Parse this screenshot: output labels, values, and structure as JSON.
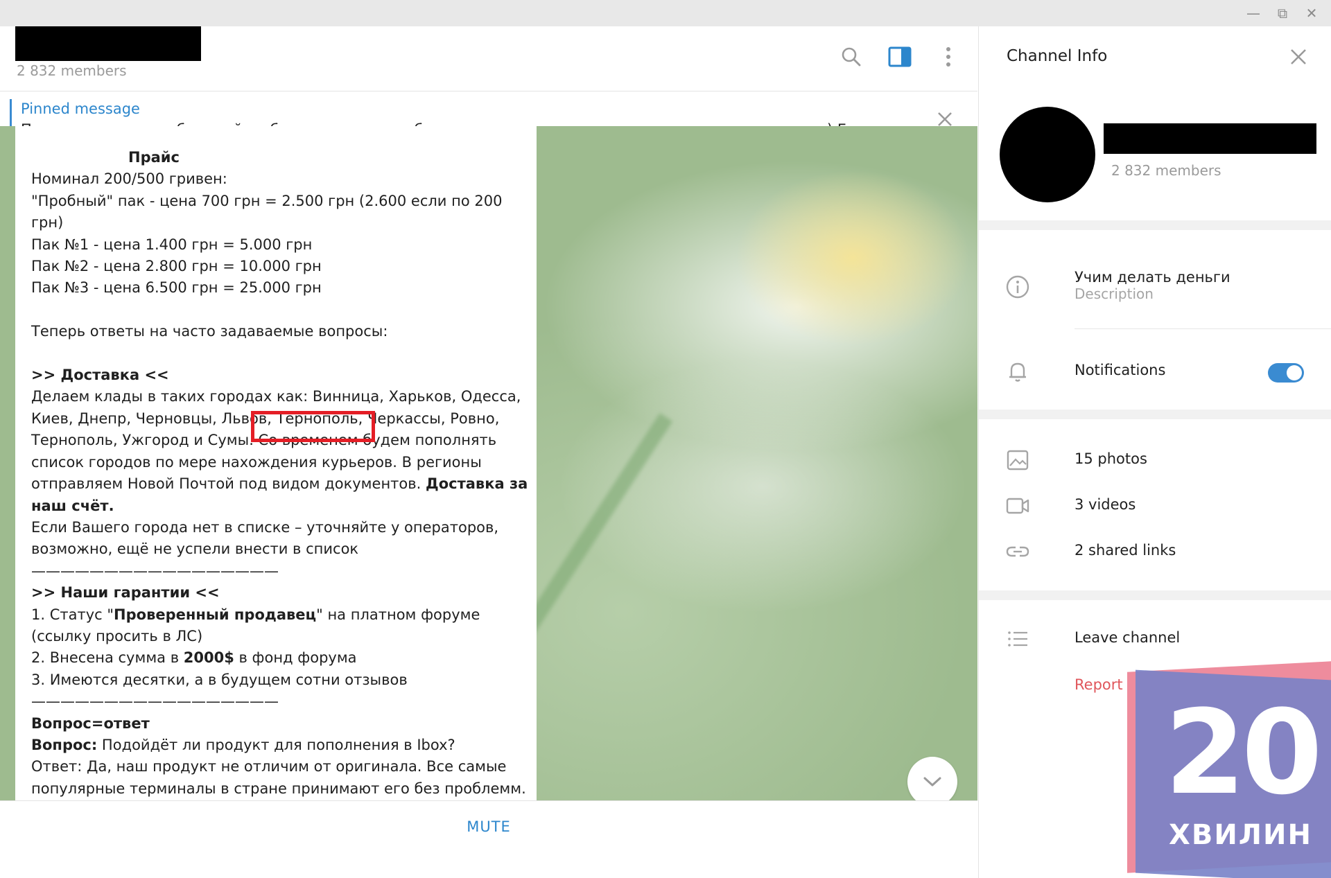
{
  "channel": {
    "members": "2 832 members"
  },
  "pinned": {
    "title": "Pinned message",
    "text": "Пацаны, магазин добротный, работаю с ними уже более полугода, что накупил – видите сами на видео) Главное де..."
  },
  "message": {
    "heading": "Прайс",
    "lines": [
      "Номинал 200/500 гривен:",
      "\"Пробный\" пак - цена 700 грн = 2.500 грн (2.600 если по 200 грн)",
      "Пак №1 - цена 1.400 грн = 5.000 грн",
      "Пак №2 - цена 2.800 грн = 10.000 грн",
      "Пак №3 - цена 6.500 грн = 25.000 грн"
    ],
    "faq_intro": "Теперь ответы на часто задаваемые вопросы:",
    "delivery_title": ">> Доставка <<",
    "delivery_text": "Делаем клады в таких городах как: Винница, Харьков, Одесса, Киев, Днепр, Черновцы, Львов, Тернополь, Черкассы, Ровно, Тернополь, Ужгород и Сумы. Со временем будем пополнять список городов по мере нахождения курьеров. В регионы отправляем Новой Почтой под видом документов.",
    "delivery_bold": "Доставка за наш счёт.",
    "delivery_note": "Если Вашего города нет в списке – уточняйте у операторов, возможно, ещё не успели внести в список",
    "separator": "—————————————————",
    "guarantees_title": ">> Наши гарантии <<",
    "g1_pre": "1. Статус \"",
    "g1_bold": "Проверенный продавец",
    "g1_post": "\" на платном форуме (ссылку просить в ЛС)",
    "g2_pre": "2. Внесена сумма в ",
    "g2_bold": "2000$",
    "g2_post": " в фонд форума",
    "g3": "3. Имеются десятки, а в будущем сотни отзывов",
    "qa_title": "Вопрос=ответ",
    "q_label": "Вопрос:",
    "q_text": " Подойдёт ли продукт для пополнения в Ibox?",
    "answer": "Ответ: Да, наш продукт не отличим от оригинала. Все самые популярные терминалы в стране принимают его без проблемм."
  },
  "bottom": {
    "mute_label": "MUTE"
  },
  "info": {
    "title": "Channel Info",
    "members": "2 832 members",
    "description_value": "Учим делать деньги",
    "description_label": "Description",
    "notifications_label": "Notifications",
    "notifications_on": true,
    "photos": "15 photos",
    "videos": "3 videos",
    "links": "2 shared links",
    "leave": "Leave channel",
    "report": "Report"
  },
  "watermark": {
    "number": "20",
    "word": "ХВИЛИН"
  },
  "colors": {
    "accent": "#2c86cc",
    "highlight": "#e41e26",
    "report": "#e0565b"
  }
}
